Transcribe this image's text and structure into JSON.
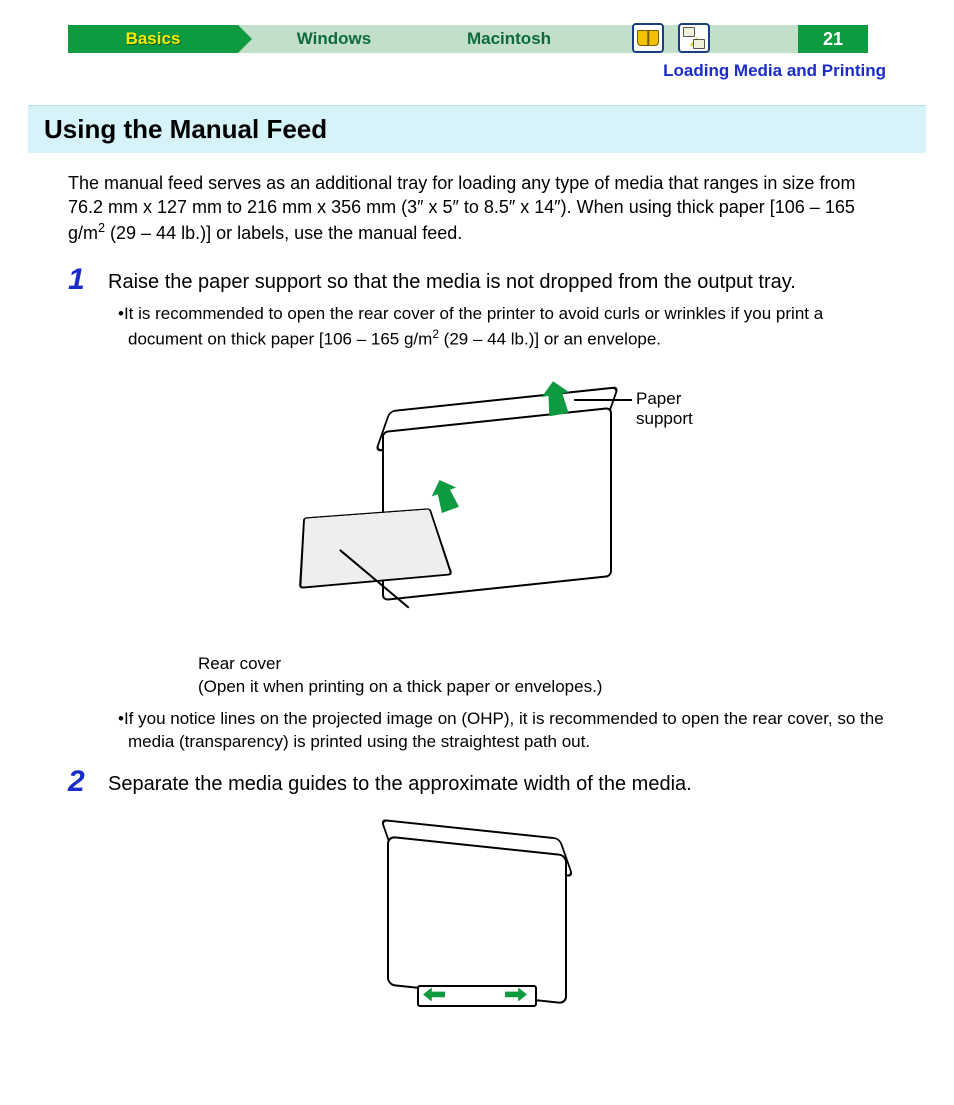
{
  "nav": {
    "tabs": [
      "Basics",
      "Windows",
      "Macintosh"
    ],
    "page_number": "21"
  },
  "breadcrumb": "Loading Media and Printing",
  "section_title": "Using the Manual Feed",
  "intro": "The manual feed serves as an additional tray for loading any type of media that ranges in size from 76.2 mm x 127 mm to 216 mm x 356 mm (3″ x 5″ to 8.5″ x 14″). When using thick paper [106 – 165 g/m",
  "intro_tail": " (29 – 44 lb.)] or labels, use the manual feed.",
  "steps": [
    {
      "num": "1",
      "text": "Raise the paper support so that the media is not dropped from the output tray.",
      "bullets": [
        {
          "pre": "It is recommended to open the rear cover of the printer to avoid curls or wrinkles if you print a document on thick paper [106 – 165 g/m",
          "post": " (29 – 44 lb.)] or an envelope."
        },
        {
          "pre": "If you notice lines on the projected image on (OHP), it is recommended to open the rear cover, so the media (transparency) is printed using the straightest path out.",
          "post": ""
        }
      ],
      "fig": {
        "label_paper_support": "Paper support",
        "label_rear_cover": "Rear cover",
        "label_rear_caption": "(Open it when printing on a thick paper or envelopes.)"
      }
    },
    {
      "num": "2",
      "text": "Separate the media guides to the approximate width of the media."
    }
  ],
  "icons": {
    "book": "book-icon",
    "network": "network-icon"
  }
}
